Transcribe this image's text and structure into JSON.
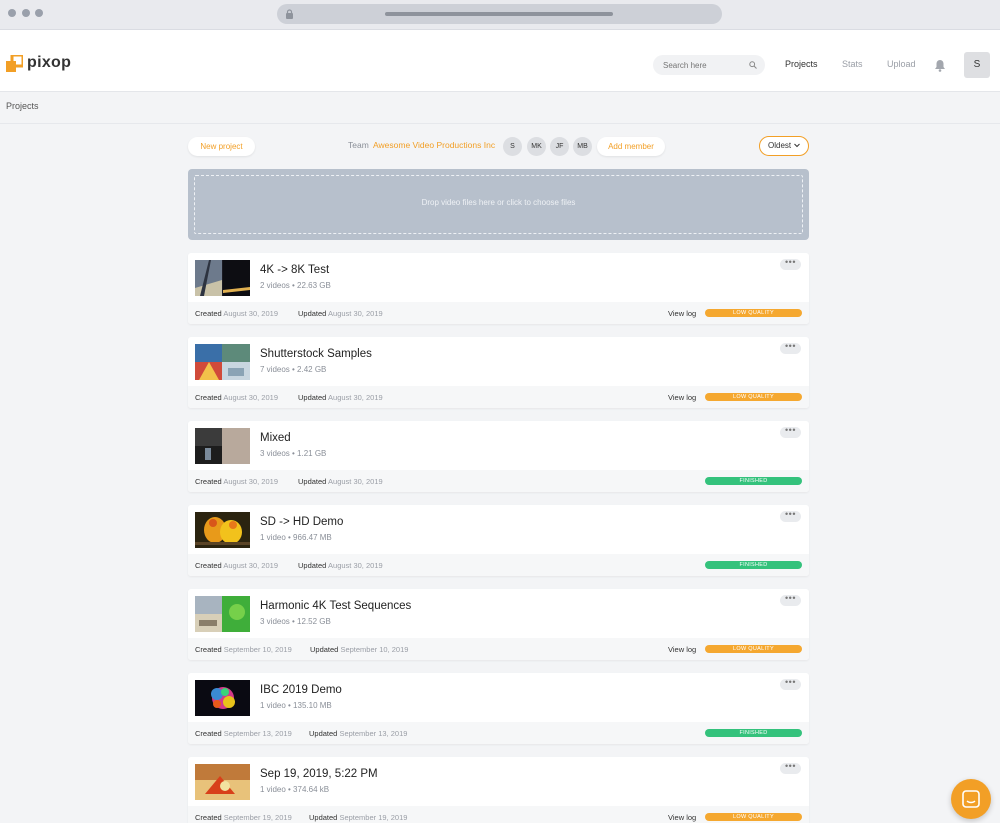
{
  "brand": {
    "name": "pixop",
    "accent": "#f29f26"
  },
  "header": {
    "search_placeholder": "Search here",
    "nav": [
      "Projects",
      "Stats",
      "Upload"
    ],
    "avatar": "S"
  },
  "breadcrumb": "Projects",
  "toolbar": {
    "new_project": "New project",
    "team_label": "Team",
    "team_name": "Awesome Video Productions Inc",
    "members": [
      "S",
      "MK",
      "JF",
      "MB"
    ],
    "add_member": "Add member",
    "sort": "Oldest"
  },
  "dropzone": "Drop video files here or click to choose files",
  "projects": [
    {
      "title": "4K -> 8K Test",
      "meta": "2 videos • 22.63 GB",
      "created": "August 30, 2019",
      "updated": "August 30, 2019",
      "view_log": "View log",
      "status": "LOW QUALITY"
    },
    {
      "title": "Shutterstock Samples",
      "meta": "7 videos • 2.42 GB",
      "created": "August 30, 2019",
      "updated": "August 30, 2019",
      "view_log": "View log",
      "status": "LOW QUALITY"
    },
    {
      "title": "Mixed",
      "meta": "3 videos • 1.21 GB",
      "created": "August 30, 2019",
      "updated": "August 30, 2019",
      "view_log": "",
      "status": "FINISHED"
    },
    {
      "title": "SD -> HD Demo",
      "meta": "1 video • 966.47 MB",
      "created": "August 30, 2019",
      "updated": "August 30, 2019",
      "view_log": "",
      "status": "FINISHED"
    },
    {
      "title": "Harmonic 4K Test Sequences",
      "meta": "3 videos • 12.52 GB",
      "created": "September 10, 2019",
      "updated": "September 10, 2019",
      "view_log": "View log",
      "status": "LOW QUALITY"
    },
    {
      "title": "IBC 2019 Demo",
      "meta": "1 video • 135.10 MB",
      "created": "September 13, 2019",
      "updated": "September 13, 2019",
      "view_log": "",
      "status": "FINISHED"
    },
    {
      "title": "Sep 19, 2019, 5:22 PM",
      "meta": "1 video • 374.64 kB",
      "created": "September 19, 2019",
      "updated": "September 19, 2019",
      "view_log": "View log",
      "status": "LOW QUALITY"
    }
  ],
  "labels": {
    "created": "Created",
    "updated": "Updated",
    "more": "•••"
  },
  "colors": {
    "low_quality": "#f5a830",
    "finished": "#34c27c",
    "dropzone": "#b7c0cc"
  }
}
